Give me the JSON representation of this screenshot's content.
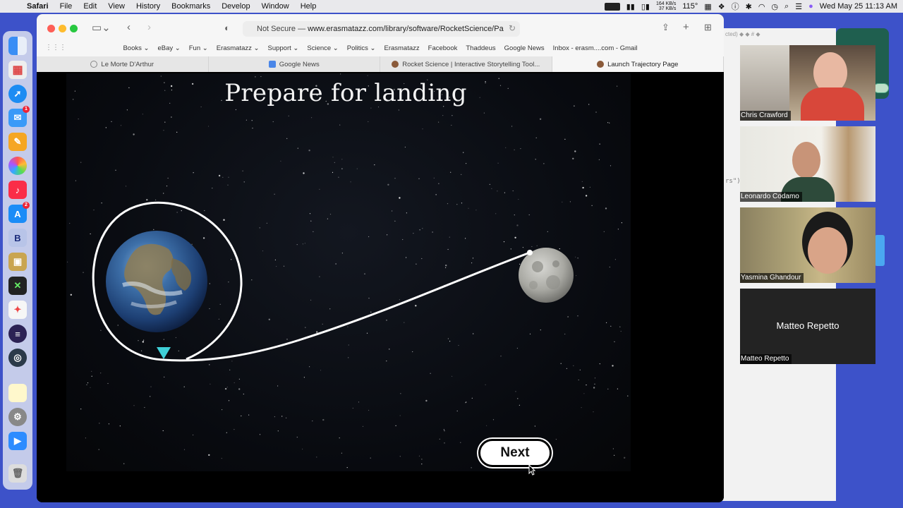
{
  "menubar": {
    "app": "Safari",
    "items": [
      "File",
      "Edit",
      "View",
      "History",
      "Bookmarks",
      "Develop",
      "Window",
      "Help"
    ],
    "net_up": "164 KB/s",
    "net_down": "37 KB/s",
    "temp": "115°",
    "clock": "Wed May 25  11:13 AM"
  },
  "browser": {
    "url_prefix": "Not Secure —",
    "url_host": "www.erasmatazz.com/library/software/RocketScience/Pa",
    "bookmarks": [
      "Books ⌄",
      "eBay ⌄",
      "Fun ⌄",
      "Erasmatazz ⌄",
      "Support ⌄",
      "Science ⌄",
      "Politics ⌄",
      "Erasmatazz",
      "Facebook",
      "Thaddeus",
      "Google News",
      "Inbox - erasm....com - Gmail"
    ],
    "tabs": [
      {
        "label": "Le Morte D'Arthur",
        "active": false
      },
      {
        "label": "Google News",
        "active": false
      },
      {
        "label": "Rocket Science | Interactive Storytelling Tool...",
        "active": false
      },
      {
        "label": "Launch Trajectory Page",
        "active": true
      }
    ]
  },
  "page": {
    "title": "Prepare for landing",
    "next_label": "Next"
  },
  "background_editor": {
    "toolbar_text": "cted)  ◆ ◆  # ◆",
    "code_text": "rs\")"
  },
  "participants": [
    {
      "name": "Chris Crawford",
      "video": true
    },
    {
      "name": "Leonardo Codamo",
      "video": true
    },
    {
      "name": "Yasmina Ghandour",
      "video": true
    },
    {
      "name": "Matteo Repetto",
      "video": false,
      "center_label": "Matteo Repetto"
    }
  ],
  "colors": {
    "accent_marker": "#3fd0d8",
    "orbit_line": "#ffffff",
    "desktop": "#3d52c9"
  }
}
